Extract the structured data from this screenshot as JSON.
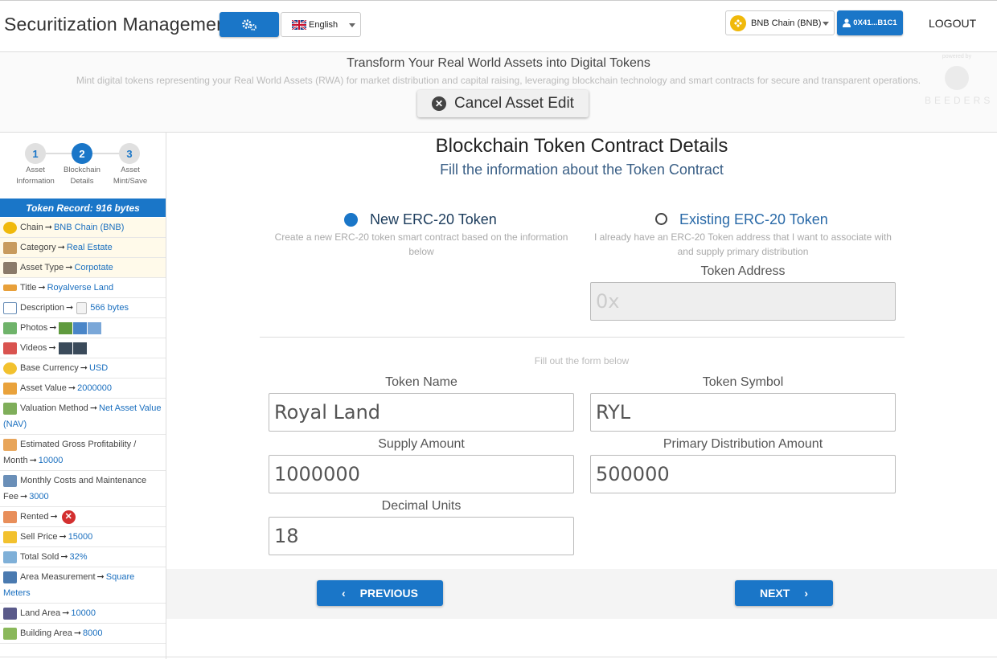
{
  "header": {
    "app_title": "Securitization Management",
    "language": "English",
    "chain": "BNB Chain (BNB)",
    "wallet": "0X41...B1C1",
    "logout": "LOGOUT"
  },
  "banner": {
    "title": "Transform Your Real World Assets into Digital Tokens",
    "subtitle": "Mint digital tokens representing your Real World Assets (RWA) for market distribution and capital raising, leveraging blockchain technology and smart contracts for secure and transparent operations.",
    "cancel_label": "Cancel Asset Edit",
    "powered_by": "powered by",
    "brand": "BEEDERS"
  },
  "stepper": {
    "steps": [
      {
        "num": "1",
        "label": "Asset Information"
      },
      {
        "num": "2",
        "label": "Blockchain Details"
      },
      {
        "num": "3",
        "label": "Asset Mint/Save"
      }
    ]
  },
  "sidebar": {
    "token_record": "Token Record: 916 bytes",
    "records": [
      {
        "label": "Chain",
        "value": "BNB Chain (BNB)"
      },
      {
        "label": "Category",
        "value": "Real Estate"
      },
      {
        "label": "Asset Type",
        "value": "Corpotate"
      },
      {
        "label": "Title",
        "value": "Royalverse Land"
      },
      {
        "label": "Description",
        "value": "566 bytes"
      },
      {
        "label": "Photos",
        "value": ""
      },
      {
        "label": "Videos",
        "value": ""
      },
      {
        "label": "Base Currency",
        "value": "USD"
      },
      {
        "label": "Asset Value",
        "value": "2000000"
      },
      {
        "label": "Valuation Method",
        "value": "Net Asset Value (NAV)"
      },
      {
        "label": "Estimated Gross Profitability / Month",
        "value": "10000"
      },
      {
        "label": "Monthly Costs and Maintenance Fee",
        "value": "3000"
      },
      {
        "label": "Rented",
        "value": ""
      },
      {
        "label": "Sell Price",
        "value": "15000"
      },
      {
        "label": "Total Sold",
        "value": "32%"
      },
      {
        "label": "Area Measurement",
        "value": "Square Meters"
      },
      {
        "label": "Land Area",
        "value": "10000"
      },
      {
        "label": "Building Area",
        "value": "8000"
      }
    ]
  },
  "main": {
    "title": "Blockchain Token Contract Details",
    "subtitle": "Fill the information about the Token Contract",
    "option_new": {
      "label": "New ERC-20 Token",
      "desc": "Create a new ERC-20 token smart contract based on the information below",
      "selected": true
    },
    "option_existing": {
      "label": "Existing ERC-20 Token",
      "desc": "I already have an ERC-20 Token address that I want to associate with and supply primary distribution",
      "selected": false
    },
    "token_address_label": "Token Address",
    "token_address_placeholder": "0x",
    "fill_note": "Fill out the form below",
    "token_name_label": "Token Name",
    "token_name": "Royal Land",
    "token_symbol_label": "Token Symbol",
    "token_symbol": "RYL",
    "supply_label": "Supply Amount",
    "supply": "1000000",
    "primary_label": "Primary Distribution Amount",
    "primary": "500000",
    "decimal_label": "Decimal Units",
    "decimal": "18",
    "prev_label": "PREVIOUS",
    "next_label": "NEXT"
  },
  "colors": {
    "accent": "#1a76c8",
    "bnb": "#f0b90b"
  }
}
